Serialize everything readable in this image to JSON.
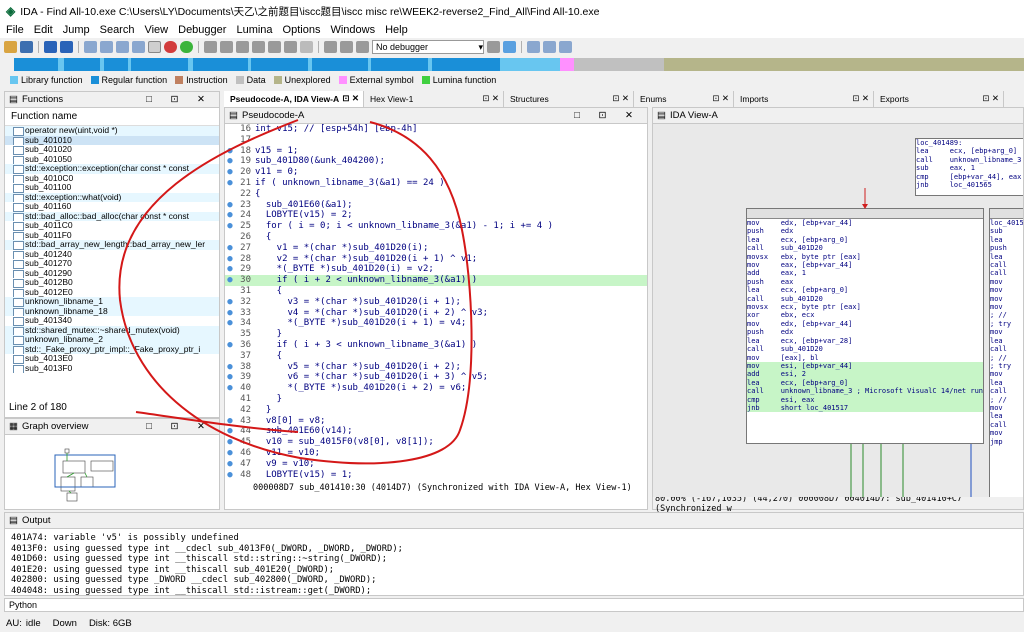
{
  "title_bar": {
    "icon": "ida-icon",
    "title": "IDA - Find All-10.exe C:\\Users\\LY\\Documents\\天乙\\之前题目\\iscc题目\\iscc misc re\\WEEK2-reverse2_Find_All\\Find All-10.exe"
  },
  "menu": [
    "File",
    "Edit",
    "Jump",
    "Search",
    "View",
    "Debugger",
    "Lumina",
    "Options",
    "Windows",
    "Help"
  ],
  "toolbar": {
    "debugger_select": "No debugger"
  },
  "legend": [
    {
      "label": "Library function",
      "color": "#68c6f0"
    },
    {
      "label": "Regular function",
      "color": "#1a8fd8"
    },
    {
      "label": "Instruction",
      "color": "#c08060"
    },
    {
      "label": "Data",
      "color": "#c0c0c0"
    },
    {
      "label": "Unexplored",
      "color": "#b5b58a"
    },
    {
      "label": "External symbol",
      "color": "#ff90ff"
    },
    {
      "label": "Lumina function",
      "color": "#40d040"
    }
  ],
  "functions": {
    "title": "Functions",
    "column": "Function name",
    "status": "Line 2 of 180",
    "items": [
      "operator new(uint,void *)",
      "sub_401010",
      "sub_401020",
      "sub_401050",
      "std::exception::exception(char const * const",
      "sub_4010C0",
      "sub_401100",
      "std::exception::what(void)",
      "sub_401160",
      "std::bad_alloc::bad_alloc(char const * const",
      "sub_4011C0",
      "sub_4011F0",
      "std::bad_array_new_length::bad_array_new_ler",
      "sub_401240",
      "sub_401270",
      "sub_401290",
      "sub_4012B0",
      "sub_4012E0",
      "unknown_libname_1",
      "unknown_libname_18",
      "sub_401340",
      "std::shared_mutex::~shared_mutex(void)",
      "unknown_libname_2",
      "std::_Fake_proxy_ptr_impl::_Fake_proxy_ptr_i",
      "sub_4013E0",
      "sub_4013F0"
    ]
  },
  "graph_overview": {
    "title": "Graph overview"
  },
  "tabs": [
    {
      "label": "Pseudocode-A, IDA View-A",
      "active": true
    },
    {
      "label": "Hex View-1"
    },
    {
      "label": "Structures"
    },
    {
      "label": "Enums"
    },
    {
      "label": "Imports"
    },
    {
      "label": "Exports"
    }
  ],
  "pseudocode": {
    "title": "Pseudocode-A",
    "status": "000008D7 sub_401410:30 (4014D7) (Synchronized with IDA View-A, Hex View-1)",
    "lines": [
      {
        "n": "16",
        "t": "int v15; // [esp+54h] [ebp-4h]",
        "bp": false
      },
      {
        "n": "17",
        "t": "",
        "bp": false
      },
      {
        "n": "18",
        "t": "v15 = 1;",
        "bp": true
      },
      {
        "n": "19",
        "t": "sub_401D80(&unk_404200);",
        "bp": true
      },
      {
        "n": "20",
        "t": "v11 = 0;",
        "bp": true
      },
      {
        "n": "21",
        "t": "if ( unknown_libname_3(&a1) == 24 )",
        "bp": true
      },
      {
        "n": "22",
        "t": "{",
        "bp": false
      },
      {
        "n": "23",
        "t": "  sub_401E60(&a1);",
        "bp": true
      },
      {
        "n": "24",
        "t": "  LOBYTE(v15) = 2;",
        "bp": true
      },
      {
        "n": "25",
        "t": "  for ( i = 0; i < unknown_libname_3(&a1) - 1; i += 4 )",
        "bp": true
      },
      {
        "n": "26",
        "t": "  {",
        "bp": false
      },
      {
        "n": "27",
        "t": "    v1 = *(char *)sub_401D20(i);",
        "bp": true
      },
      {
        "n": "28",
        "t": "    v2 = *(char *)sub_401D20(i + 1) ^ v1;",
        "bp": true
      },
      {
        "n": "29",
        "t": "    *(_BYTE *)sub_401D20(i) = v2;",
        "bp": true
      },
      {
        "n": "30",
        "t": "    if ( i + 2 < unknown_libname_3(&a1) )",
        "bp": true,
        "hl": true
      },
      {
        "n": "31",
        "t": "    {",
        "bp": false
      },
      {
        "n": "32",
        "t": "      v3 = *(char *)sub_401D20(i + 1);",
        "bp": true
      },
      {
        "n": "33",
        "t": "      v4 = *(char *)sub_401D20(i + 2) ^ v3;",
        "bp": true
      },
      {
        "n": "34",
        "t": "      *(_BYTE *)sub_401D20(i + 1) = v4;",
        "bp": true
      },
      {
        "n": "35",
        "t": "    }",
        "bp": false
      },
      {
        "n": "36",
        "t": "    if ( i + 3 < unknown_libname_3(&a1) )",
        "bp": true
      },
      {
        "n": "37",
        "t": "    {",
        "bp": false
      },
      {
        "n": "38",
        "t": "      v5 = *(char *)sub_401D20(i + 2);",
        "bp": true
      },
      {
        "n": "39",
        "t": "      v6 = *(char *)sub_401D20(i + 3) ^ v5;",
        "bp": true
      },
      {
        "n": "40",
        "t": "      *(_BYTE *)sub_401D20(i + 2) = v6;",
        "bp": true
      },
      {
        "n": "41",
        "t": "    }",
        "bp": false
      },
      {
        "n": "42",
        "t": "  }",
        "bp": false
      },
      {
        "n": "43",
        "t": "  v8[0] = v8;",
        "bp": true
      },
      {
        "n": "44",
        "t": "  sub_401E60(v14);",
        "bp": true
      },
      {
        "n": "45",
        "t": "  v10 = sub_4015F0(v8[0], v8[1]);",
        "bp": true
      },
      {
        "n": "46",
        "t": "  v11 = v10;",
        "bp": true
      },
      {
        "n": "47",
        "t": "  v9 = v10;",
        "bp": true
      },
      {
        "n": "48",
        "t": "  LOBYTE(v15) = 1;",
        "bp": true
      }
    ]
  },
  "ida_view": {
    "title": "IDA View-A",
    "status": "80.00% (-167,1035) (44,270) 000008D7 004014D7: sub_401410+C7 (Synchronized w",
    "block_top": [
      "loc_401489:",
      "lea     ecx, [ebp+arg_0]",
      "call    unknown_libname_3 ;",
      "sub     eax, 1",
      "cmp     [ebp+var_44], eax",
      "jnb     loc_401565"
    ],
    "block_main": [
      "mov     edx, [ebp+var_44]",
      "push    edx",
      "lea     ecx, [ebp+arg_0]",
      "call    sub_401D20",
      "movsx   ebx, byte ptr [eax]",
      "mov     eax, [ebp+var_44]",
      "add     eax, 1",
      "push    eax",
      "lea     ecx, [ebp+arg_0]",
      "call    sub_401D20",
      "movsx   ecx, byte ptr [eax]",
      "xor     ebx, ecx",
      "mov     edx, [ebp+var_44]",
      "push    edx",
      "lea     ecx, [ebp+var_28]",
      "call    sub_401D20",
      "mov     [eax], bl",
      "mov     esi, [ebp+var_44]",
      "add     esi, 2",
      "lea     ecx, [ebp+arg_0]",
      "call    unknown_libname_3 ; Microsoft VisualC 14/net runtime",
      "cmp     esi, eax",
      "jnb     short loc_401517"
    ],
    "block_right": [
      "loc_4015",
      "sub",
      "lea",
      "push",
      "lea",
      "call",
      "call",
      "mov",
      "mov",
      "mov",
      "mov",
      "; //",
      "; try",
      "mov",
      "lea",
      "call",
      "; //",
      "; try",
      "mov",
      "lea",
      "call",
      "; //",
      "mov",
      "lea",
      "call",
      "mov",
      "jmp"
    ]
  },
  "output": {
    "title": "Output",
    "lines": [
      "401A74: variable 'v5' is possibly undefined",
      "4013F0: using guessed type int __cdecl sub_4013F0(_DWORD, _DWORD, _DWORD);",
      "401D60: using guessed type int __thiscall std::string::~string(_DWORD);",
      "401E20: using guessed type int __thiscall sub_401E20(_DWORD);",
      "402800: using guessed type _DWORD __cdecl sub_402800(_DWORD, _DWORD);",
      "404048: using guessed type int __thiscall std::istream::get(_DWORD);"
    ],
    "input_label": "Python"
  },
  "status_bar": {
    "au": "AU:",
    "state": "idle",
    "direction": "Down",
    "disk": "Disk: 6GB"
  }
}
